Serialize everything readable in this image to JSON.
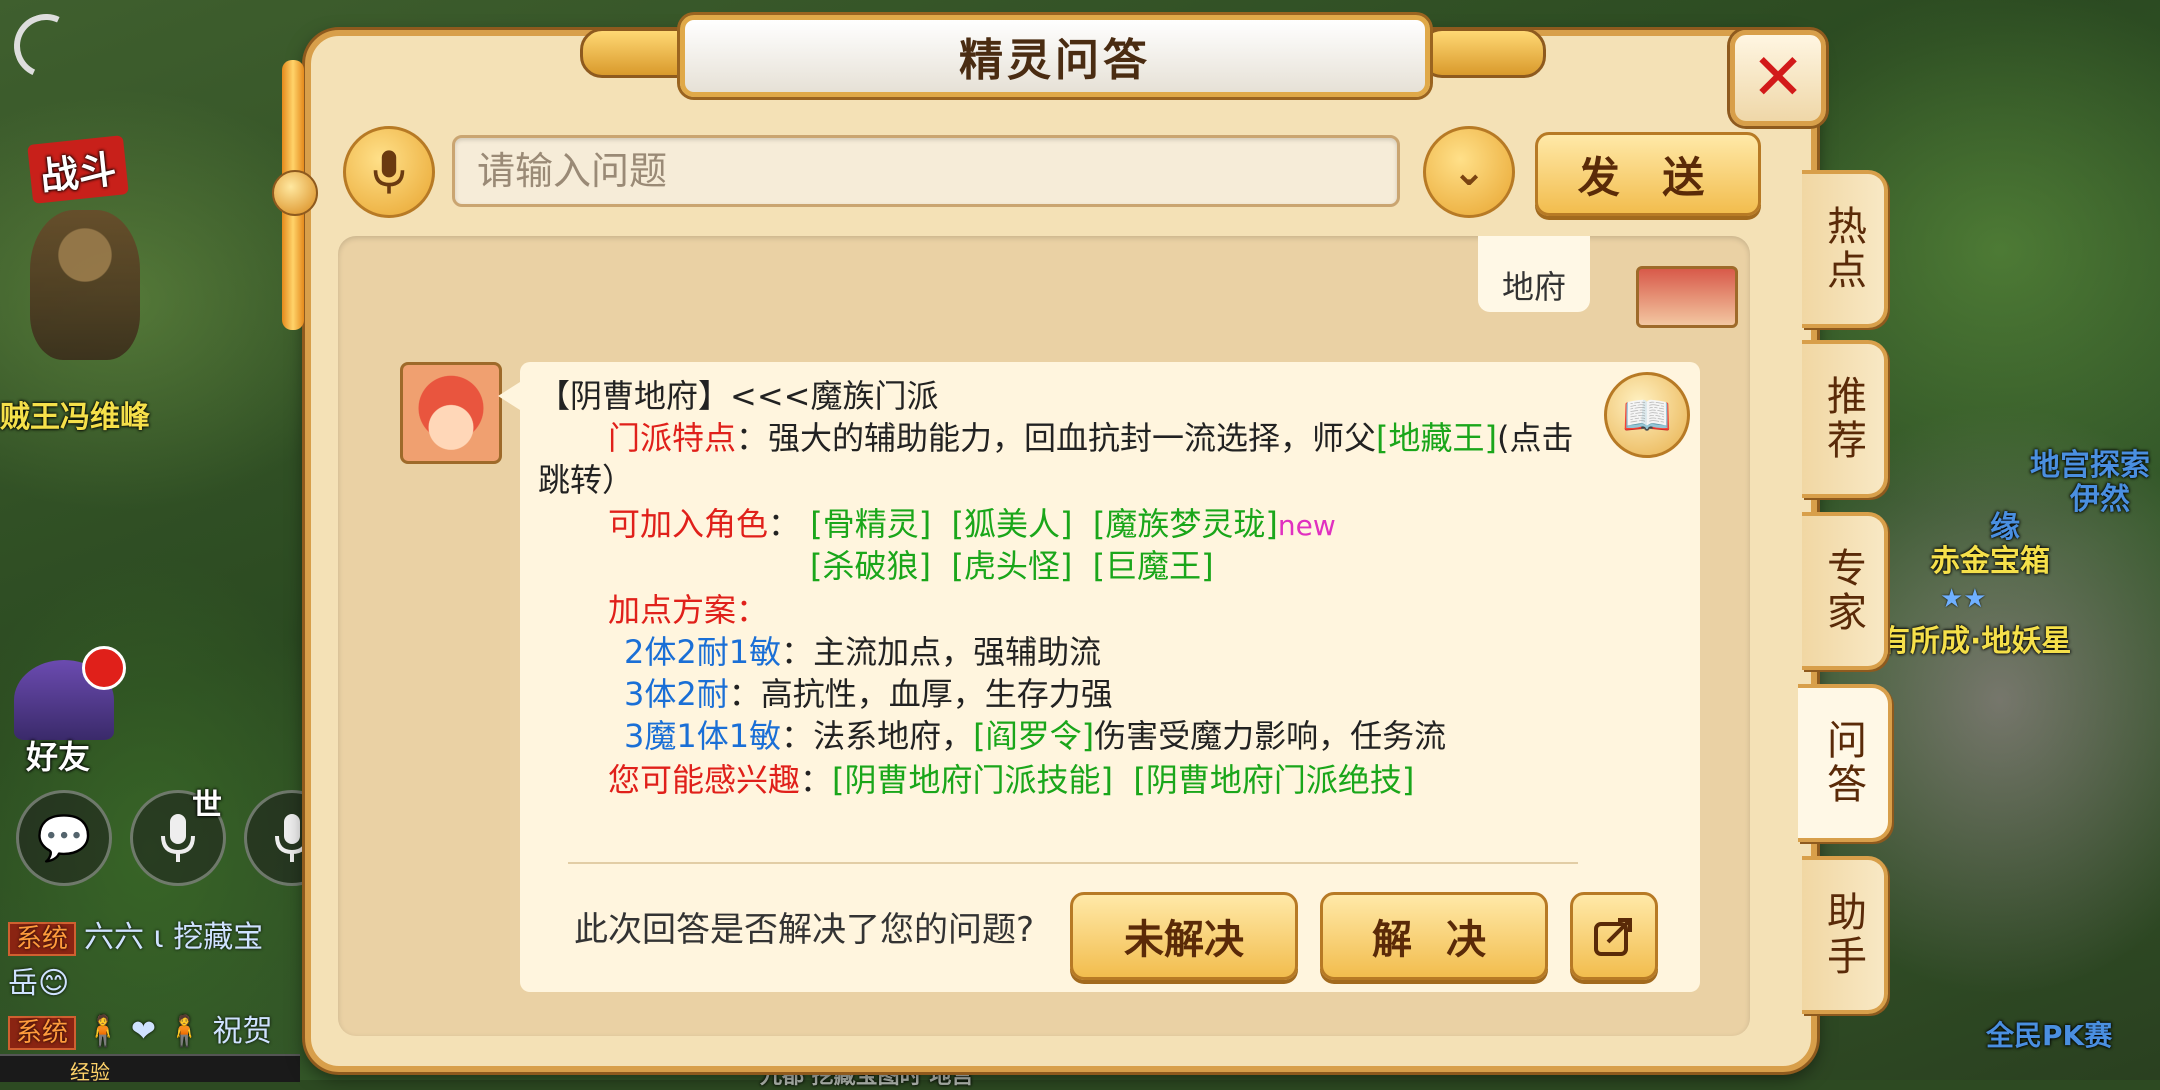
{
  "game": {
    "battle_label": "战斗",
    "npc_name": "贼王冯维峰",
    "friends_label": "好友",
    "world_label": "世",
    "right_labels": [
      "地宫探索",
      "伊然",
      "缘",
      "赤金宝箱",
      "有所成·地妖星",
      "全民PK赛"
    ],
    "chat_lines": [
      {
        "tag": "系统",
        "text": "六六 ι 挖藏宝"
      },
      {
        "tag": "",
        "text": "岳😊"
      },
      {
        "tag": "系统",
        "text": "祝贺"
      }
    ],
    "exp_label": "经验",
    "bottom_text": "九都  挖藏宝图时   地宫"
  },
  "dialog": {
    "title": "精灵问答",
    "close_icon": "close-icon"
  },
  "search": {
    "placeholder": "请输入问题",
    "send_label": "发 送"
  },
  "chat": {
    "user_message": "地府",
    "answer": {
      "heading": "【阴曹地府】<<<魔族门派",
      "feature_label": "门派特点",
      "feature_text": "：强大的辅助能力，回血抗封一流选择，师父",
      "master_link": "[地藏王]",
      "feature_tail": "(点击",
      "jump_text": "跳转）",
      "roles_label": "可加入角色",
      "roles_row1": [
        "[骨精灵]",
        "[狐美人]",
        "[魔族梦灵珑]"
      ],
      "new_badge": "new",
      "roles_row2": [
        "[杀破狼]",
        "[虎头怪]",
        "[巨魔王]"
      ],
      "plan_label": "加点方案：",
      "plans": [
        {
          "key": "2体2耐1敏",
          "desc": "：主流加点，强辅助流"
        },
        {
          "key": "3体2耐",
          "desc": "：高抗性，血厚，生存力强"
        },
        {
          "key": "3魔1体1敏",
          "desc": "：法系地府，",
          "link": "[阎罗令]",
          "tail": "伤害受魔力影响，任务流"
        }
      ],
      "interest_label": "您可能感兴趣",
      "interest_links": [
        "[阴曹地府门派技能]",
        "[阴曹地府门派绝技]"
      ]
    },
    "feedback": {
      "question": "此次回答是否解决了您的问题?",
      "unsolved_label": "未解决",
      "solved_label": "解 决"
    }
  },
  "side_tabs": [
    {
      "label": "热点",
      "active": false
    },
    {
      "label": "推荐",
      "active": false
    },
    {
      "label": "专家",
      "active": false
    },
    {
      "label": "问答",
      "active": true
    },
    {
      "label": "助手",
      "active": false
    }
  ]
}
